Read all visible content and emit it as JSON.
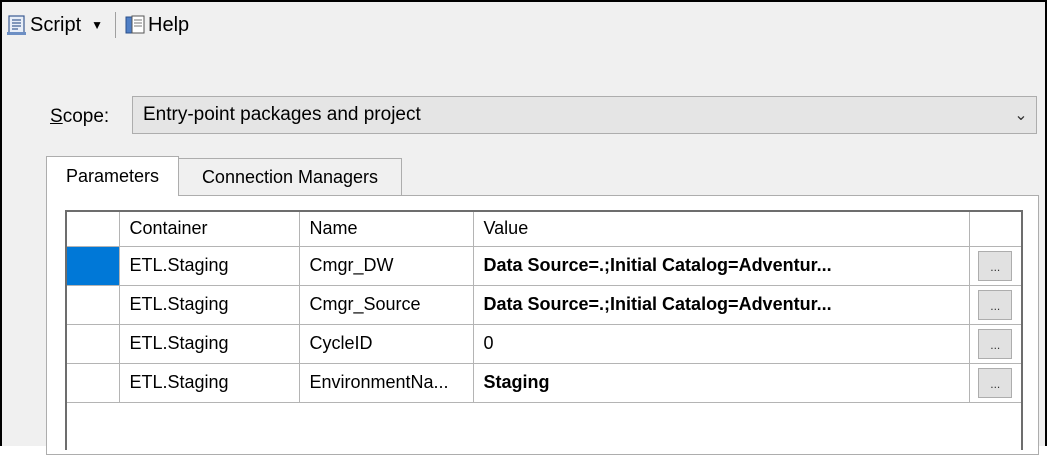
{
  "toolbar": {
    "script_label": "Script",
    "script_icon": "script-icon",
    "help_label": "Help",
    "help_icon": "help-icon"
  },
  "scope": {
    "label": "Scope:",
    "value": "Entry-point packages and project"
  },
  "tabs": [
    {
      "label": "Parameters",
      "active": true
    },
    {
      "label": "Connection Managers",
      "active": false
    }
  ],
  "grid": {
    "columns": [
      "Container",
      "Name",
      "Value"
    ],
    "rows": [
      {
        "container": "ETL.Staging",
        "name": "Cmgr_DW",
        "value": "Data Source=.;Initial Catalog=Adventur...",
        "bold": true,
        "button": "..."
      },
      {
        "container": "ETL.Staging",
        "name": "Cmgr_Source",
        "value": "Data Source=.;Initial Catalog=Adventur...",
        "bold": true,
        "button": "..."
      },
      {
        "container": "ETL.Staging",
        "name": "CycleID",
        "value": "0",
        "bold": false,
        "button": "..."
      },
      {
        "container": "ETL.Staging",
        "name": "EnvironmentNa...",
        "value": "Staging",
        "bold": true,
        "button": "..."
      }
    ]
  },
  "colors": {
    "selection": "#0078d7",
    "window_bg": "#f0f0f0"
  }
}
